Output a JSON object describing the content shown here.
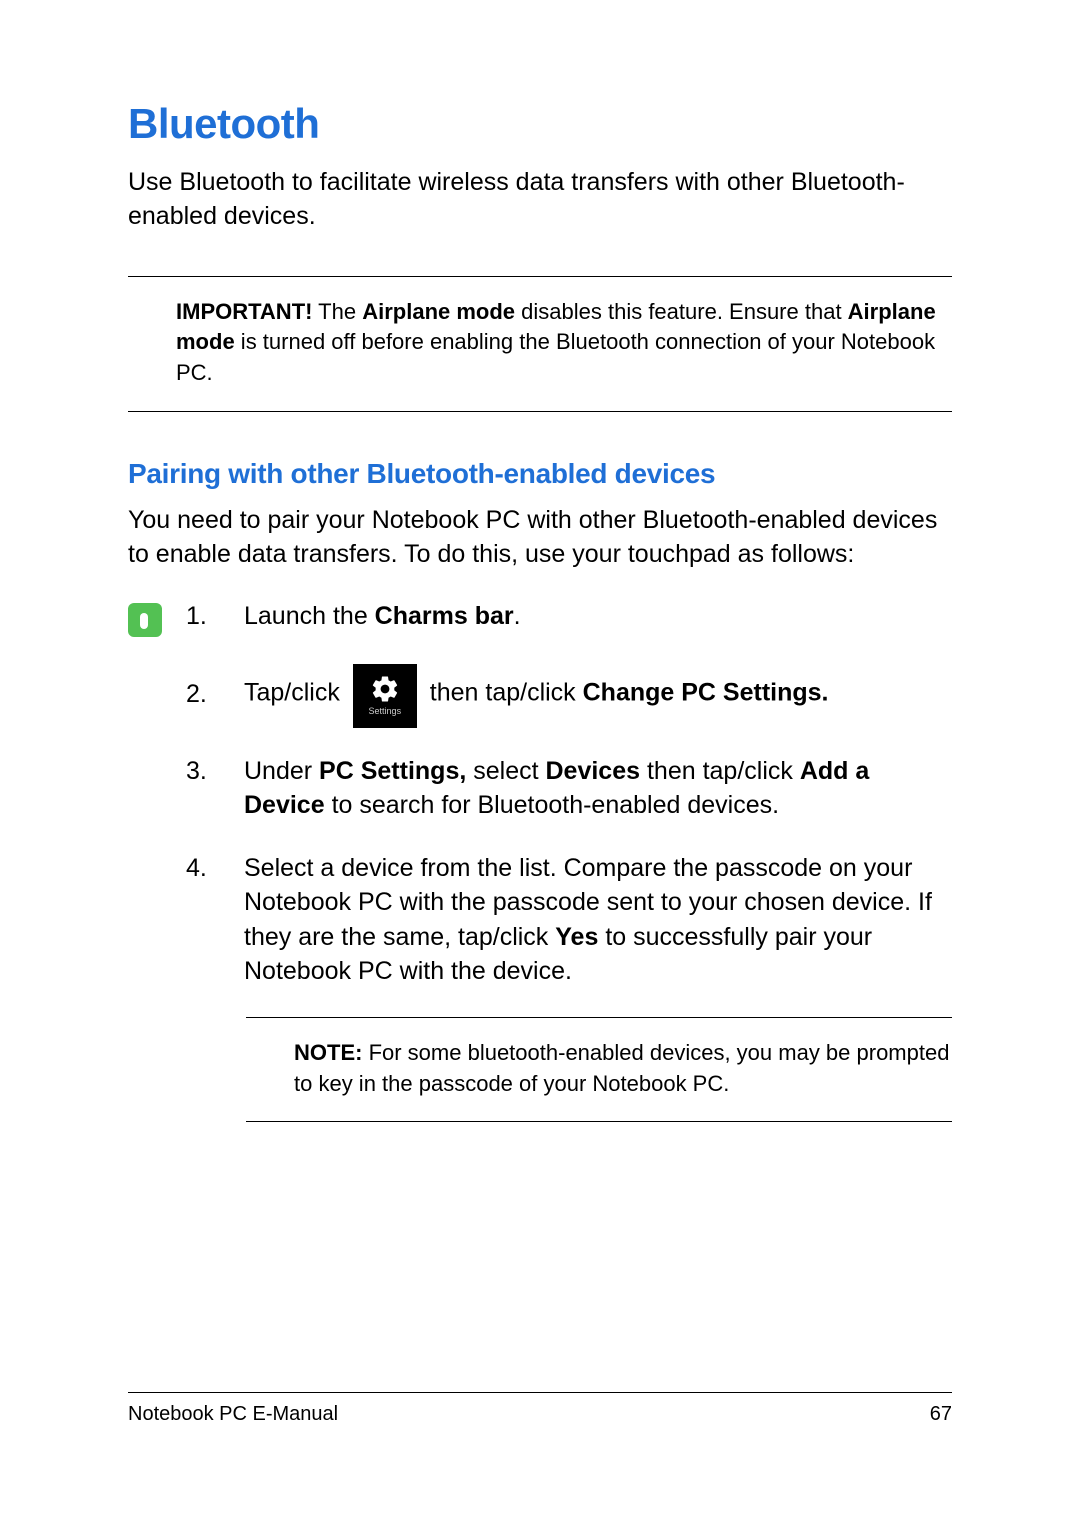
{
  "section": {
    "title": "Bluetooth",
    "intro": "Use Bluetooth to facilitate wireless data transfers with other Bluetooth-enabled devices."
  },
  "important": {
    "label": "IMPORTANT!",
    "text_before": " The ",
    "term1": "Airplane mode",
    "text_mid": " disables this feature. Ensure that ",
    "term2": "Airplane mode",
    "text_after": " is turned off before enabling the Bluetooth connection of your Notebook PC."
  },
  "subsection": {
    "title": "Pairing with other Bluetooth-enabled devices",
    "intro": "You need to pair your Notebook PC with other Bluetooth-enabled devices to enable data transfers. To do this, use your touchpad as follows:"
  },
  "steps": {
    "s1": {
      "num": "1.",
      "a": "Launch the ",
      "b": "Charms bar",
      "c": "."
    },
    "s2": {
      "num": "2.",
      "a": "Tap/click ",
      "tile_label": "Settings",
      "b": " then tap/click ",
      "c": "Change PC Settings."
    },
    "s3": {
      "num": "3.",
      "a": "Under ",
      "b": "PC Settings,",
      "c": " select ",
      "d": "Devices",
      "e": " then tap/click ",
      "f": "Add a Device",
      "g": " to search for Bluetooth-enabled devices."
    },
    "s4": {
      "num": "4.",
      "a": "Select a device from the list. Compare the passcode on your Notebook PC with the passcode sent to your chosen device. If they are the same, tap/click ",
      "b": "Yes",
      "c": " to successfully pair your Notebook PC with the device."
    }
  },
  "note": {
    "label": "NOTE:",
    "text": "  For some bluetooth-enabled devices, you may be prompted to key in the passcode of your Notebook PC."
  },
  "footer": {
    "doc": "Notebook PC E-Manual",
    "page": "67"
  }
}
